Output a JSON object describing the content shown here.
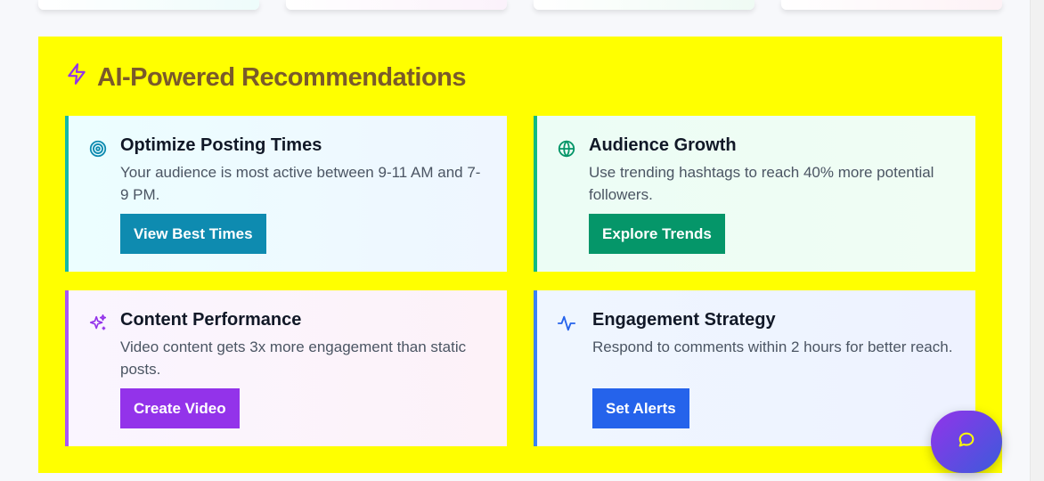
{
  "section": {
    "title": "AI-Powered Recommendations",
    "background": "#ffff00",
    "title_color": "#7a5a2a"
  },
  "recommendations": [
    {
      "title": "Optimize Posting Times",
      "description": "Your audience is most active between 9-11 AM and 7-9 PM.",
      "button": "View Best Times",
      "icon": "target-icon",
      "accent": "#14b8a6",
      "button_color": "#0e8bb0"
    },
    {
      "title": "Audience Growth",
      "description": "Use trending hashtags to reach 40% more potential followers.",
      "button": "Explore Trends",
      "icon": "globe-icon",
      "accent": "#10b981",
      "button_color": "#059669"
    },
    {
      "title": "Content Performance",
      "description": "Video content gets 3x more engagement than static posts.",
      "button": "Create Video",
      "icon": "sparkles-icon",
      "accent": "#a855f7",
      "button_color": "#9333ea"
    },
    {
      "title": "Engagement Strategy",
      "description": "Respond to comments within 2 hours for better reach.",
      "button": "Set Alerts",
      "icon": "activity-icon",
      "accent": "#3b82f6",
      "button_color": "#2563eb"
    }
  ],
  "chat": {
    "icon": "chat-bubble-icon"
  }
}
